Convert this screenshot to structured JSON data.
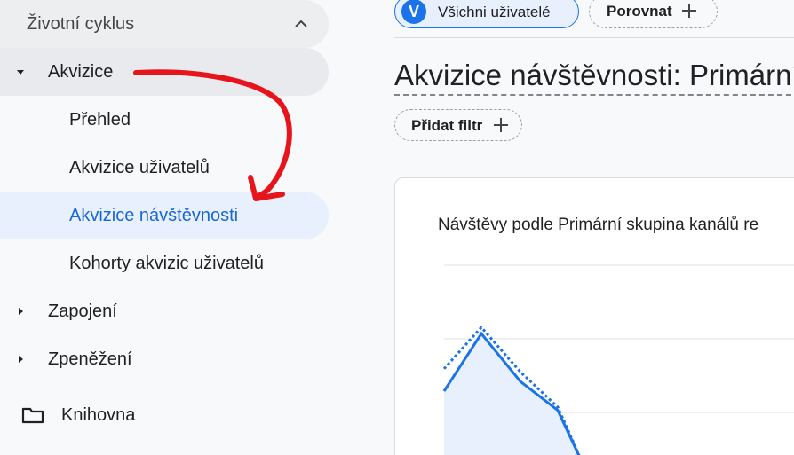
{
  "sidebar": {
    "section_title": "Životní cyklus",
    "items": [
      {
        "label": "Akvizice"
      },
      {
        "label": "Přehled"
      },
      {
        "label": "Akvizice uživatelů"
      },
      {
        "label": "Akvizice návštěvnosti"
      },
      {
        "label": "Kohorty akvizic uživatelů"
      },
      {
        "label": "Zapojení"
      },
      {
        "label": "Zpeněžení"
      }
    ],
    "library_label": "Knihovna"
  },
  "main": {
    "segment_chip": {
      "avatar": "V",
      "label": "Všichni uživatelé"
    },
    "compare_label": "Porovnat",
    "title": "Akvizice návštěvnosti: Primární",
    "filter_label": "Přidat filtr",
    "card_title": "Návštěvy podle Primární skupina kanálů re"
  },
  "chart_data": {
    "type": "line",
    "series": [
      {
        "values": [
          25,
          43,
          28,
          19,
          0
        ]
      },
      {
        "values": [
          32,
          45,
          31,
          20,
          0
        ]
      }
    ]
  },
  "colors": {
    "accent": "#1a73e8",
    "active_text": "#1967d2",
    "annotation": "#e8141c"
  }
}
